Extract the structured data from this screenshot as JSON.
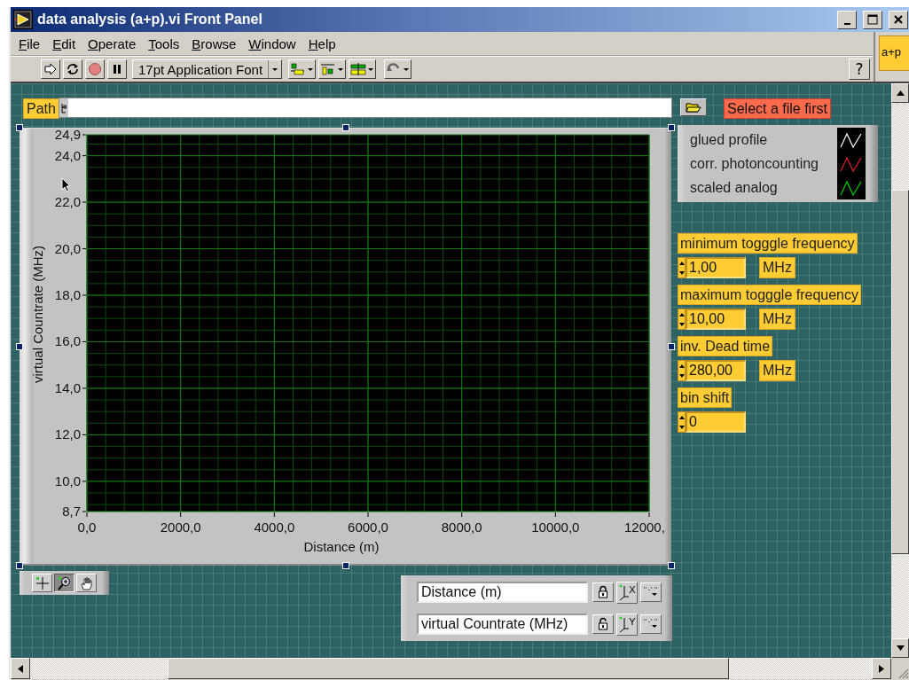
{
  "window": {
    "title": "data analysis (a+p).vi Front Panel"
  },
  "menu": [
    {
      "label": "File"
    },
    {
      "label": "Edit"
    },
    {
      "label": "Operate"
    },
    {
      "label": "Tools"
    },
    {
      "label": "Browse"
    },
    {
      "label": "Window"
    },
    {
      "label": "Help"
    }
  ],
  "toolbar": {
    "font": "17pt Application Font",
    "help": "?"
  },
  "vi_icon": {
    "text": "a+p"
  },
  "path": {
    "label": "Path"
  },
  "status": {
    "text": "Select a file first"
  },
  "graph": {
    "chart_data": {
      "type": "line",
      "grid": true,
      "xlabel": "Distance (m)",
      "ylabel": "virtual Countrate (MHz)",
      "xlim": [
        0,
        12000
      ],
      "ylim": [
        8.7,
        24.9
      ],
      "xticks": [
        {
          "value": 0,
          "label": "0,0"
        },
        {
          "value": 2000,
          "label": "2000,0"
        },
        {
          "value": 4000,
          "label": "4000,0"
        },
        {
          "value": 6000,
          "label": "6000,0"
        },
        {
          "value": 8000,
          "label": "8000,0"
        },
        {
          "value": 10000,
          "label": "10000,0"
        },
        {
          "value": 12000,
          "label": "12000,"
        }
      ],
      "yticks": [
        {
          "value": 8.7,
          "label": "8,7"
        },
        {
          "value": 10,
          "label": "10,0"
        },
        {
          "value": 12,
          "label": "12,0"
        },
        {
          "value": 14,
          "label": "14,0"
        },
        {
          "value": 16,
          "label": "16,0"
        },
        {
          "value": 18,
          "label": "18,0"
        },
        {
          "value": 20,
          "label": "20,0"
        },
        {
          "value": 22,
          "label": "22,0"
        },
        {
          "value": 24,
          "label": "24,0"
        },
        {
          "value": 24.9,
          "label": "24,9"
        }
      ]
    }
  },
  "plot_legend": [
    {
      "name": "glued profile",
      "color": "#ffffff"
    },
    {
      "name": "corr. photoncounting",
      "color": "#e02020"
    },
    {
      "name": "scaled analog",
      "color": "#00d000"
    }
  ],
  "controls": [
    {
      "label": "minimum togggle frequency",
      "value": "1,00",
      "unit": "MHz"
    },
    {
      "label": "maximum togggle frequency",
      "value": "10,00",
      "unit": "MHz"
    },
    {
      "label": "inv. Dead time",
      "value": "280,00",
      "unit": "MHz"
    },
    {
      "label": "bin shift",
      "value": "0"
    }
  ],
  "graph_palette": [
    {
      "kind": "crosshair",
      "selected": false
    },
    {
      "kind": "zoom",
      "selected": true
    },
    {
      "kind": "pan",
      "selected": false
    }
  ],
  "scale_legend": [
    {
      "name": "Distance (m)",
      "axis": "X",
      "locked": true
    },
    {
      "name": "virtual Countrate (MHz)",
      "axis": "Y",
      "locked": false
    }
  ]
}
